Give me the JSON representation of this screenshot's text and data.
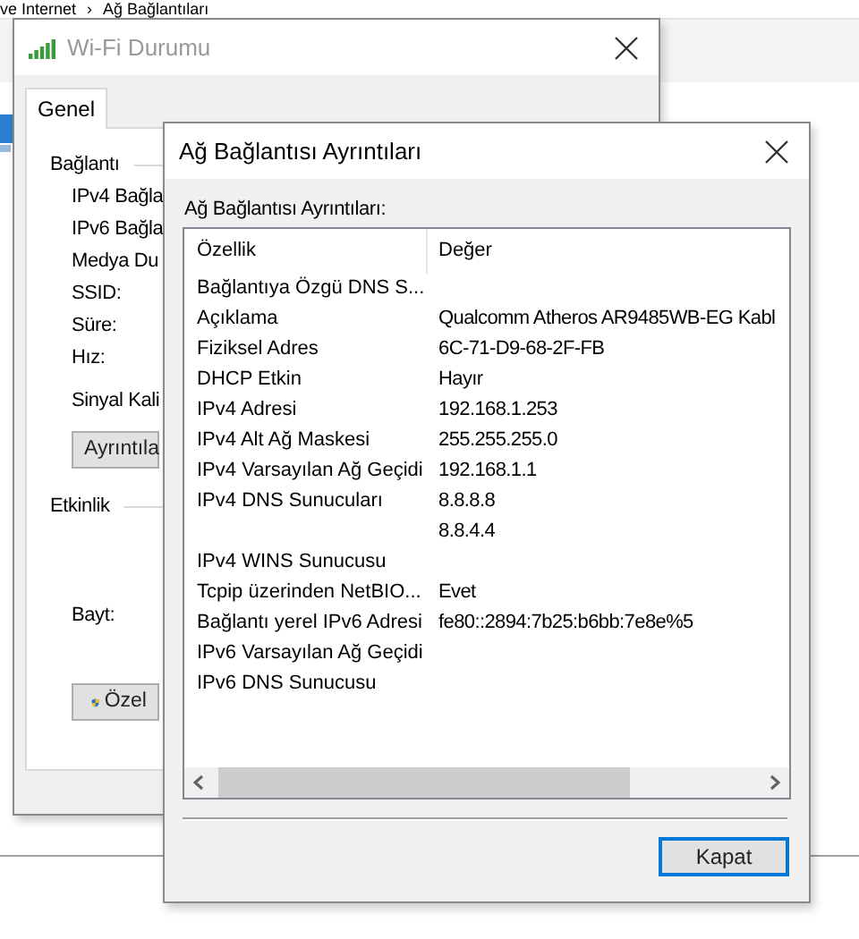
{
  "background": {
    "breadcrumb": [
      "ve Internet",
      "›",
      "Ağ Bağlantıları"
    ]
  },
  "status_window": {
    "title": "Wi-Fi Durumu",
    "active": false,
    "tabs": [
      {
        "label": "Genel",
        "selected": true
      }
    ],
    "connection_heading": "Bağlantı",
    "connection_labels": [
      "IPv4 Bağla",
      "IPv6 Bağla",
      "Medya Du",
      "SSID:",
      "Süre:",
      "Hız:"
    ],
    "signal_label": "Sinyal Kali",
    "details_button": "Ayrıntıla",
    "activity_heading": "Etkinlik",
    "bytes_label": "Bayt:",
    "properties_button": "Özel"
  },
  "details_window": {
    "title": "Ağ Bağlantısı Ayrıntıları",
    "active": true,
    "list_label": "Ağ Bağlantısı Ayrıntıları:",
    "columns": [
      "Özellik",
      "Değer"
    ],
    "rows": [
      {
        "property": "Bağlantıya Özgü DNS S..."
      },
      {
        "property": "Açıklama",
        "value": "Qualcomm Atheros AR9485WB-EG Kabl"
      },
      {
        "property": "Fiziksel Adres",
        "value": "6C-71-D9-68-2F-FB"
      },
      {
        "property": "DHCP Etkin",
        "value": "Hayır"
      },
      {
        "property": "IPv4 Adresi",
        "value": "192.168.1.253"
      },
      {
        "property": "IPv4 Alt Ağ Maskesi",
        "value": "255.255.255.0"
      },
      {
        "property": "IPv4 Varsayılan Ağ Geçidi",
        "value": "192.168.1.1"
      },
      {
        "property": "IPv4 DNS Sunucuları",
        "value": "8.8.8.8"
      },
      {
        "value": "8.8.4.4"
      },
      {
        "property": "IPv4 WINS Sunucusu"
      },
      {
        "property": "Tcpip üzerinden NetBIO...",
        "value": "Evet"
      },
      {
        "property": "Bağlantı yerel IPv6 Adresi",
        "value": "fe80::2894:7b25:b6bb:7e8e%5"
      },
      {
        "property": "IPv6 Varsayılan Ağ Geçidi"
      },
      {
        "property": "IPv6 DNS Sunucusu"
      }
    ],
    "close_button": "Kapat"
  }
}
